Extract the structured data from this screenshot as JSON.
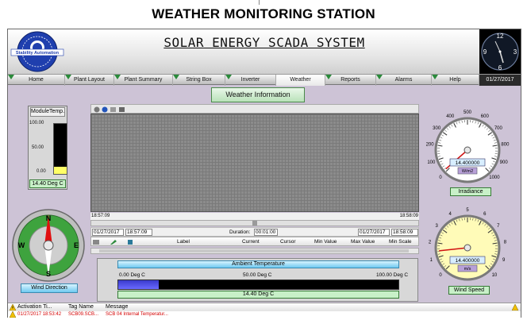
{
  "page_title": "WEATHER MONITORING STATION",
  "header": {
    "system_title": "SOLAR ENERGY SCADA  SYSTEM",
    "logo_text": "Stability Automation",
    "clock_numbers": {
      "n12": "12",
      "n3": "3",
      "n6": "6",
      "n9": "9"
    }
  },
  "nav": {
    "tabs": [
      "Home",
      "Plant Layout",
      "Plant Summary",
      "String Box",
      "Inverter",
      "Weather",
      "Reports",
      "Alarms",
      "Help"
    ],
    "active": "Weather",
    "date": "01/27/2017"
  },
  "weather_tab": "Weather Information",
  "module_temp": {
    "title": "ModuleTemp.",
    "scale": [
      "100.00",
      "50.00",
      "0.00"
    ],
    "value_text": "14.40 Deg C",
    "fraction": 0.144
  },
  "trend": {
    "start_time": "18:57:09",
    "end_time": "18:58:09",
    "start_date": "01/27/2017",
    "start_clock": "18:57:09",
    "duration_label": "Duration:",
    "duration": "00:01:00",
    "end_date": "01/27/2017",
    "end_clock": "18:58:09",
    "columns": [
      "Label",
      "Current",
      "Cursor",
      "Min Value",
      "Max Value",
      "Min Scale"
    ]
  },
  "ambient": {
    "title": "Ambient Temperature",
    "scale": [
      "0.00 Deg C",
      "50.00 Deg C",
      "100.00 Deg C"
    ],
    "value_text": "14.40 Deg C",
    "fraction": 0.144
  },
  "wind_direction": {
    "label": "Wind Direction",
    "points": {
      "n": "N",
      "e": "E",
      "s": "S",
      "w": "W"
    },
    "heading_deg": 0
  },
  "irradiance": {
    "label": "Irradiance",
    "ticks": [
      "0",
      "100",
      "200",
      "300",
      "400",
      "500",
      "600",
      "700",
      "800",
      "900",
      "1000"
    ],
    "value": "14.400000",
    "unit": "W/m2",
    "reading": 14.4,
    "max": 1000
  },
  "wind_speed": {
    "label": "Wind Speed",
    "ticks": [
      "0",
      "1",
      "2",
      "3",
      "4",
      "5",
      "6",
      "7",
      "8",
      "9",
      "10"
    ],
    "value": "14.400000",
    "unit": "m/s",
    "reading": 1.44,
    "max": 10
  },
  "alarms": {
    "columns": [
      "Activation Ti...",
      "Tag Name",
      "Message"
    ],
    "rows": [
      {
        "time": "01/27/2017  18:53:42",
        "tag": "SCB09.SCB...",
        "message": "SCB 04 Internal Temperatur..."
      }
    ]
  },
  "colors": {
    "accent_green": "#2a8a3a",
    "panel_bg": "#cdc3d6",
    "alarm_red": "#d40000",
    "bar_blue": "#3a3acc"
  }
}
